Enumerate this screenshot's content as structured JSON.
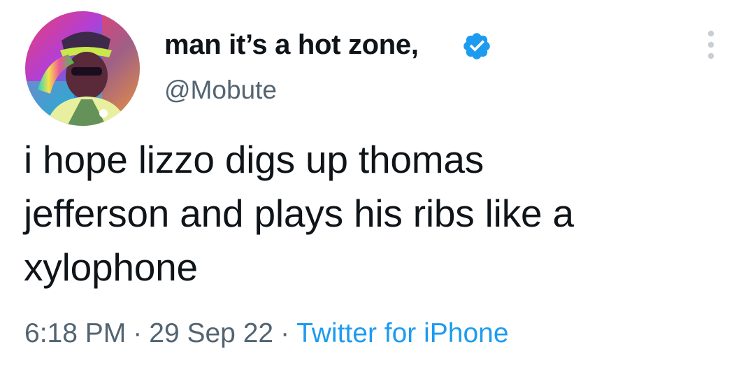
{
  "tweet": {
    "display_name": "man it’s a hot zone,",
    "handle": "@Mobute",
    "verified": true,
    "avatar_icon": "saluting-man-avatar",
    "more_icon": "more-options-icon",
    "text_lines": [
      "i hope lizzo digs up thomas",
      "jefferson and plays his ribs like a",
      "xylophone"
    ],
    "time": "6:18 PM",
    "date": "29 Sep 22",
    "separator": "·",
    "source": "Twitter for iPhone"
  },
  "colors": {
    "text": "#0f1419",
    "secondary": "#536471",
    "accent": "#1d9bf0",
    "background": "#ffffff"
  }
}
